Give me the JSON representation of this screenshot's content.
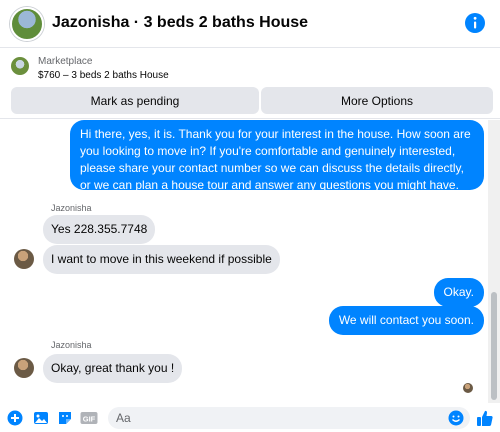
{
  "header": {
    "title": "Jazonisha · 3 beds 2 baths House"
  },
  "listing": {
    "context_label": "Marketplace",
    "price_title": "$760 – 3 beds 2 baths House",
    "mark_pending_label": "Mark as pending",
    "more_options_label": "More Options"
  },
  "messages": [
    {
      "type": "outgoing",
      "text": "Hi there, yes, it is. Thank you for your interest in the house. How soon are you looking to move in? If you're comfortable and genuinely interested, please share your contact number so we can discuss the details directly, or we can plan a house tour and answer any questions you might have."
    },
    {
      "type": "incoming",
      "sender": "Jazonisha",
      "text": "Yes 228.355.7748"
    },
    {
      "type": "incoming",
      "text": "I want to move in this weekend if possible"
    },
    {
      "type": "outgoing",
      "text": "Okay."
    },
    {
      "type": "outgoing",
      "text": "We will contact you soon."
    },
    {
      "type": "incoming",
      "sender": "Jazonisha",
      "text": "Okay, great thank you !"
    }
  ],
  "composer": {
    "placeholder": "Aa"
  },
  "colors": {
    "accent": "#0084ff",
    "incoming_bubble": "#e4e6eb",
    "background": "#ffffff"
  },
  "icons": [
    "info-icon",
    "plus-icon",
    "image-icon",
    "sticker-icon",
    "gif-icon",
    "emoji-icon",
    "like-icon"
  ]
}
